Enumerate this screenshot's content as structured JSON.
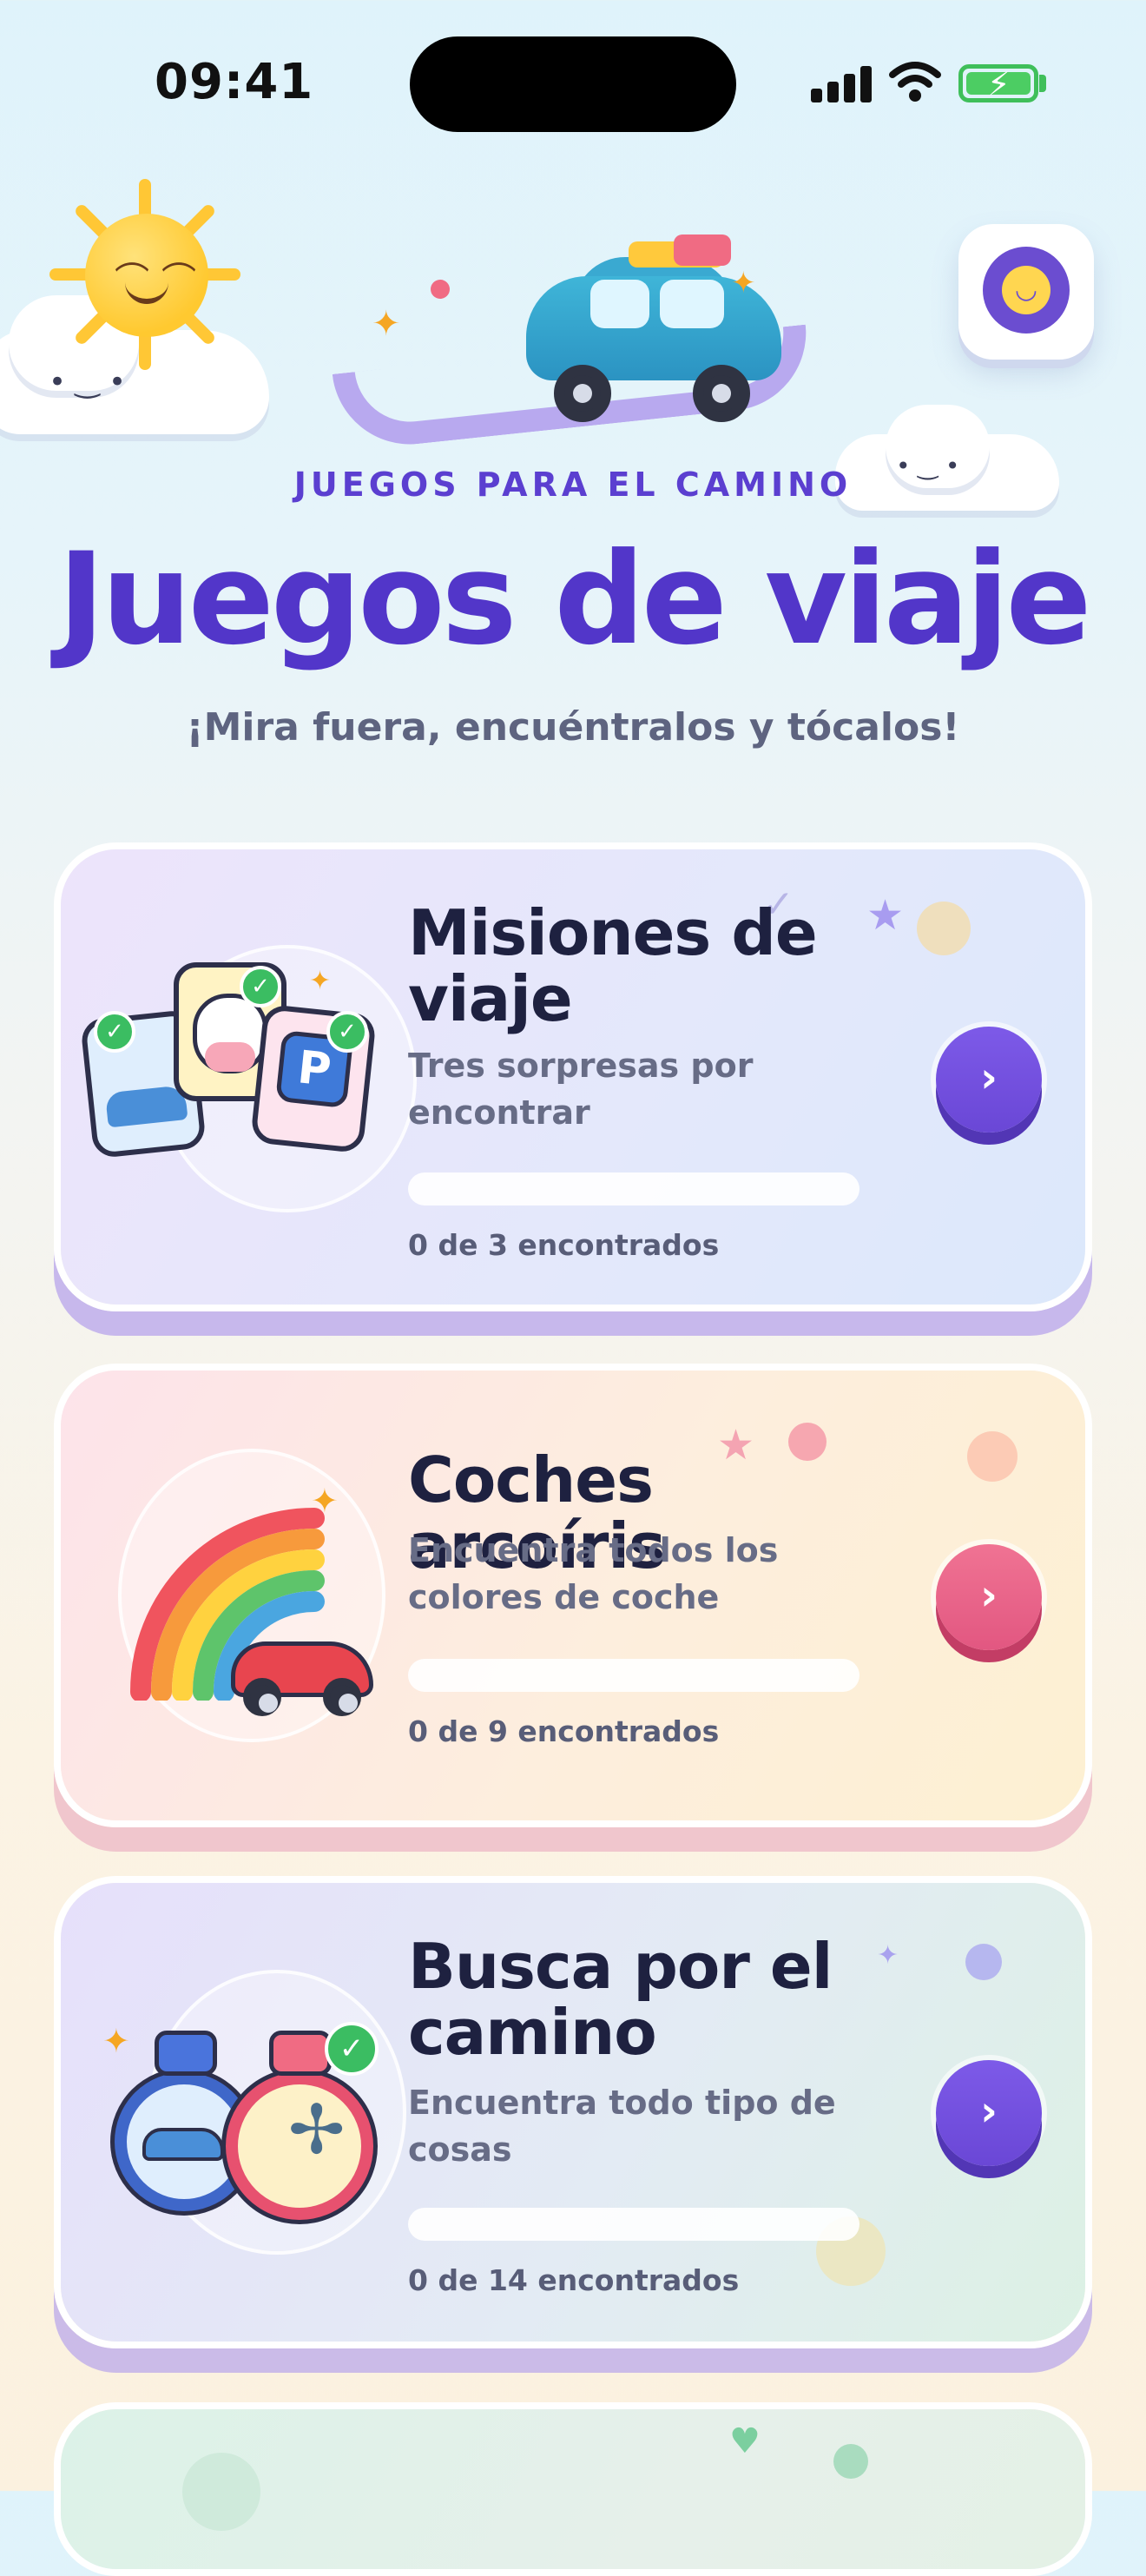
{
  "status_bar": {
    "time": "09:41"
  },
  "header": {
    "kicker": "JUEGOS PARA EL CAMINO",
    "title": "Juegos de viaje",
    "subtitle": "¡Mira fuera, encuéntralos y tócalos!"
  },
  "cards": [
    {
      "title": "Misiones de viaje",
      "subtitle": "Tres sorpresas por encontrar",
      "progress_text": "0 de 3 encontrados",
      "progress": 0,
      "accent": "#6b4dd6",
      "icon": "chevron-right-icon"
    },
    {
      "title": "Coches arcoíris",
      "subtitle": "Encuentra todos los colores de coche",
      "progress_text": "0 de 9 encontrados",
      "progress": 0,
      "accent": "#e8628b",
      "icon": "chevron-right-icon"
    },
    {
      "title": "Busca por el camino",
      "subtitle": "Encuentra todo tipo de cosas",
      "progress_text": "0 de 14 encontrados",
      "progress": 0,
      "accent": "#6b4dd6",
      "icon": "chevron-right-icon"
    },
    {
      "title": "",
      "subtitle": "",
      "progress_text": "",
      "progress": 0,
      "accent": "#7bcf9f",
      "icon": ""
    }
  ],
  "tile_letter": "P",
  "chevron": "›"
}
